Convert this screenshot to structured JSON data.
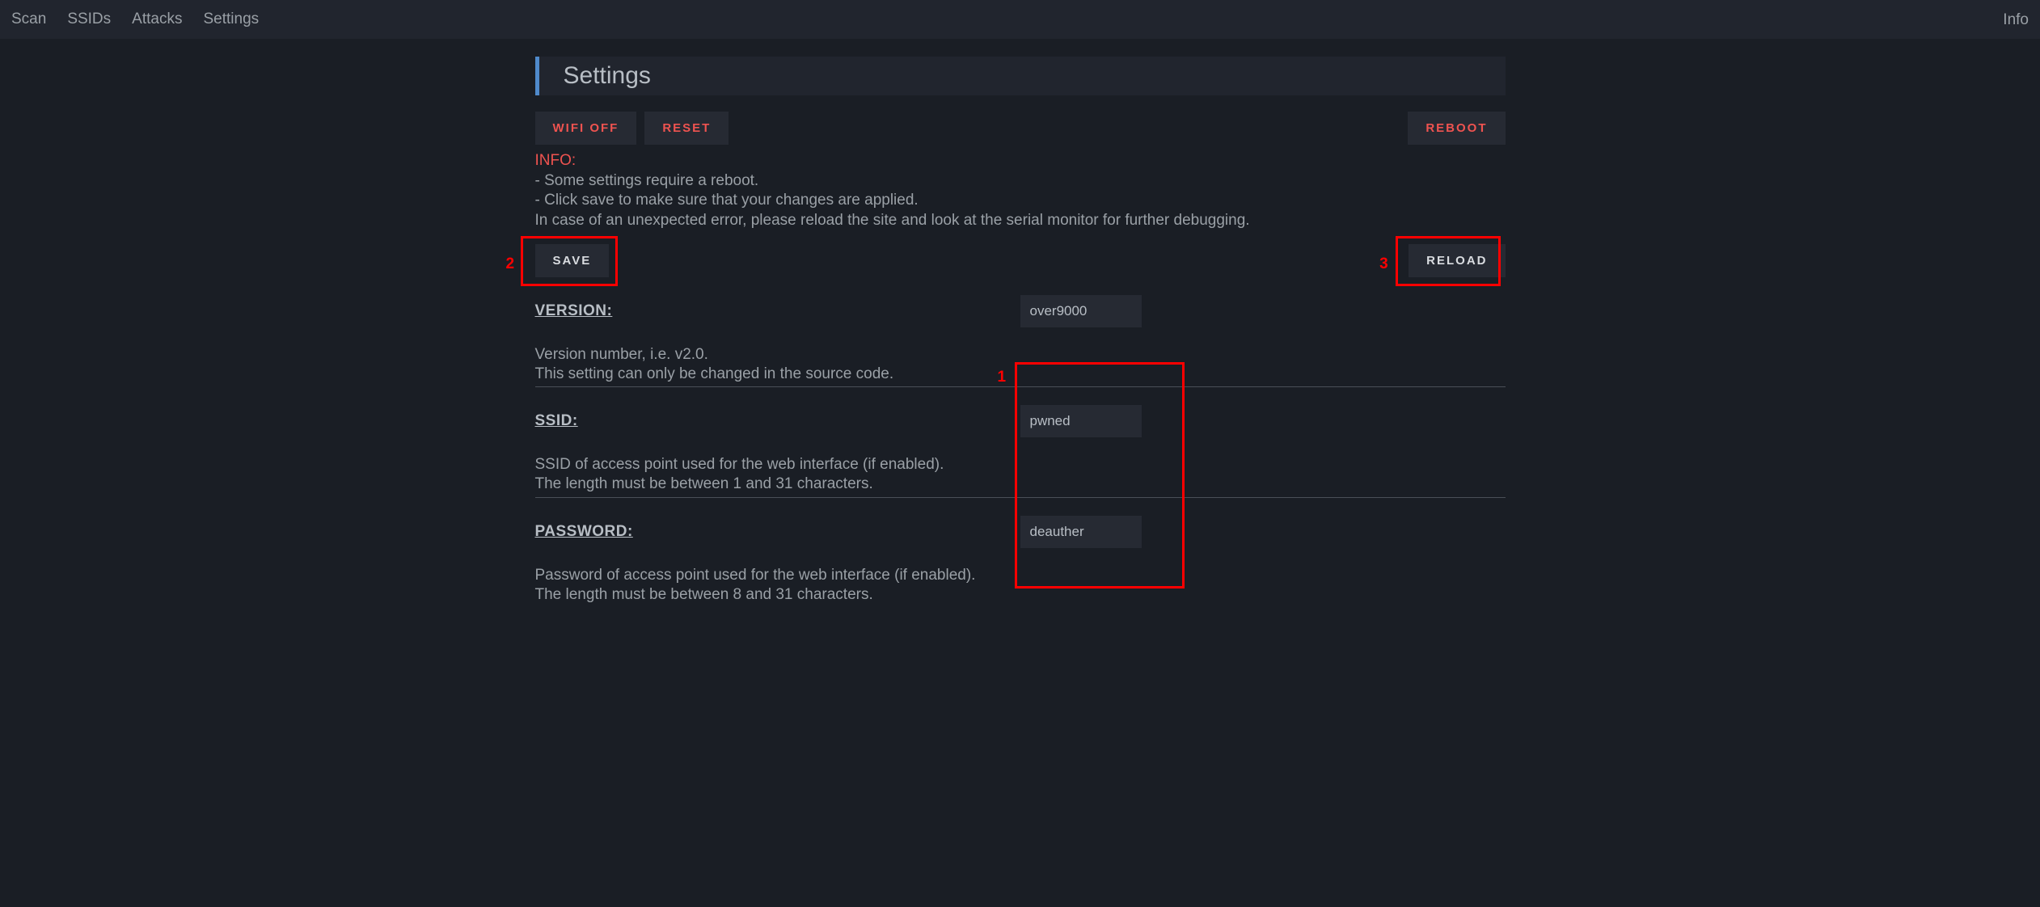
{
  "nav": {
    "items": [
      "Scan",
      "SSIDs",
      "Attacks",
      "Settings"
    ],
    "right": "Info"
  },
  "page_title": "Settings",
  "buttons": {
    "wifi_off": "WIFI OFF",
    "reset": "RESET",
    "reboot": "REBOOT",
    "save": "SAVE",
    "reload": "RELOAD"
  },
  "info": {
    "label": "INFO:",
    "line1": "- Some settings require a reboot.",
    "line2": "- Click save to make sure that your changes are applied.",
    "line3": "In case of an unexpected error, please reload the site and look at the serial monitor for further debugging."
  },
  "settings": {
    "version": {
      "label": "VERSION:",
      "value": "over9000",
      "desc1": "Version number, i.e. v2.0.",
      "desc2": "This setting can only be changed in the source code."
    },
    "ssid": {
      "label": "SSID:",
      "value": "pwned",
      "desc1": "SSID of access point used for the web interface (if enabled).",
      "desc2": "The length must be between 1 and 31 characters."
    },
    "password": {
      "label": "PASSWORD:",
      "value": "deauther",
      "desc1": "Password of access point used for the web interface (if enabled).",
      "desc2": "The length must be between 8 and 31 characters."
    }
  },
  "annotations": {
    "n1": "1",
    "n2": "2",
    "n3": "3"
  }
}
